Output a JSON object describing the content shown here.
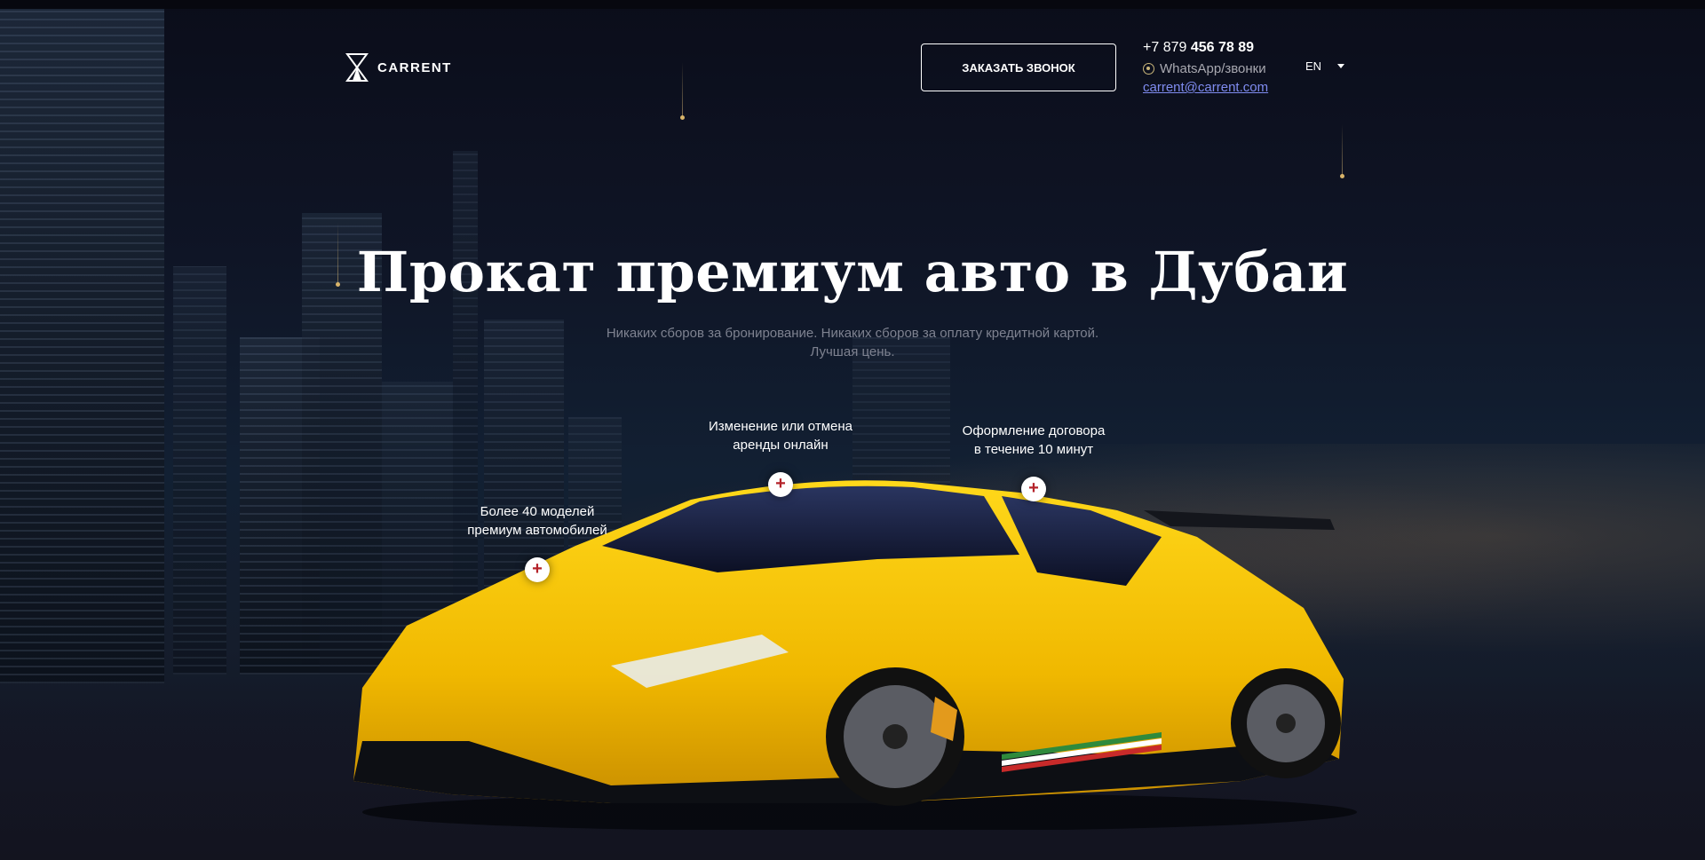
{
  "brand": {
    "name": "CARRENT"
  },
  "header": {
    "call_button": "ЗАКАЗАТЬ ЗВОНОК",
    "phone_prefix": "+7 879 ",
    "phone_main": "456 78 89",
    "whatsapp_label": "WhatsApp/звонки",
    "email": "carrent@carrent.com",
    "language": "EN"
  },
  "hero": {
    "title": "Прокат премиум авто в Дубаи",
    "subtitle": "Никаких сборов за бронирование. Никаких сборов за оплату кредитной картой. Лучшая цень."
  },
  "features": [
    {
      "label": "Более 40 моделей\nпремиум автомобилей",
      "icon": "plus-icon"
    },
    {
      "label": "Изменение или отмена\nаренды онлайн",
      "icon": "plus-icon"
    },
    {
      "label": "Оформление договора\nв течение 10 минут",
      "icon": "plus-icon"
    }
  ],
  "colors": {
    "accent_link": "#7f8cf0",
    "car": "#f5c400",
    "hotspot_plus": "#b4232a"
  }
}
